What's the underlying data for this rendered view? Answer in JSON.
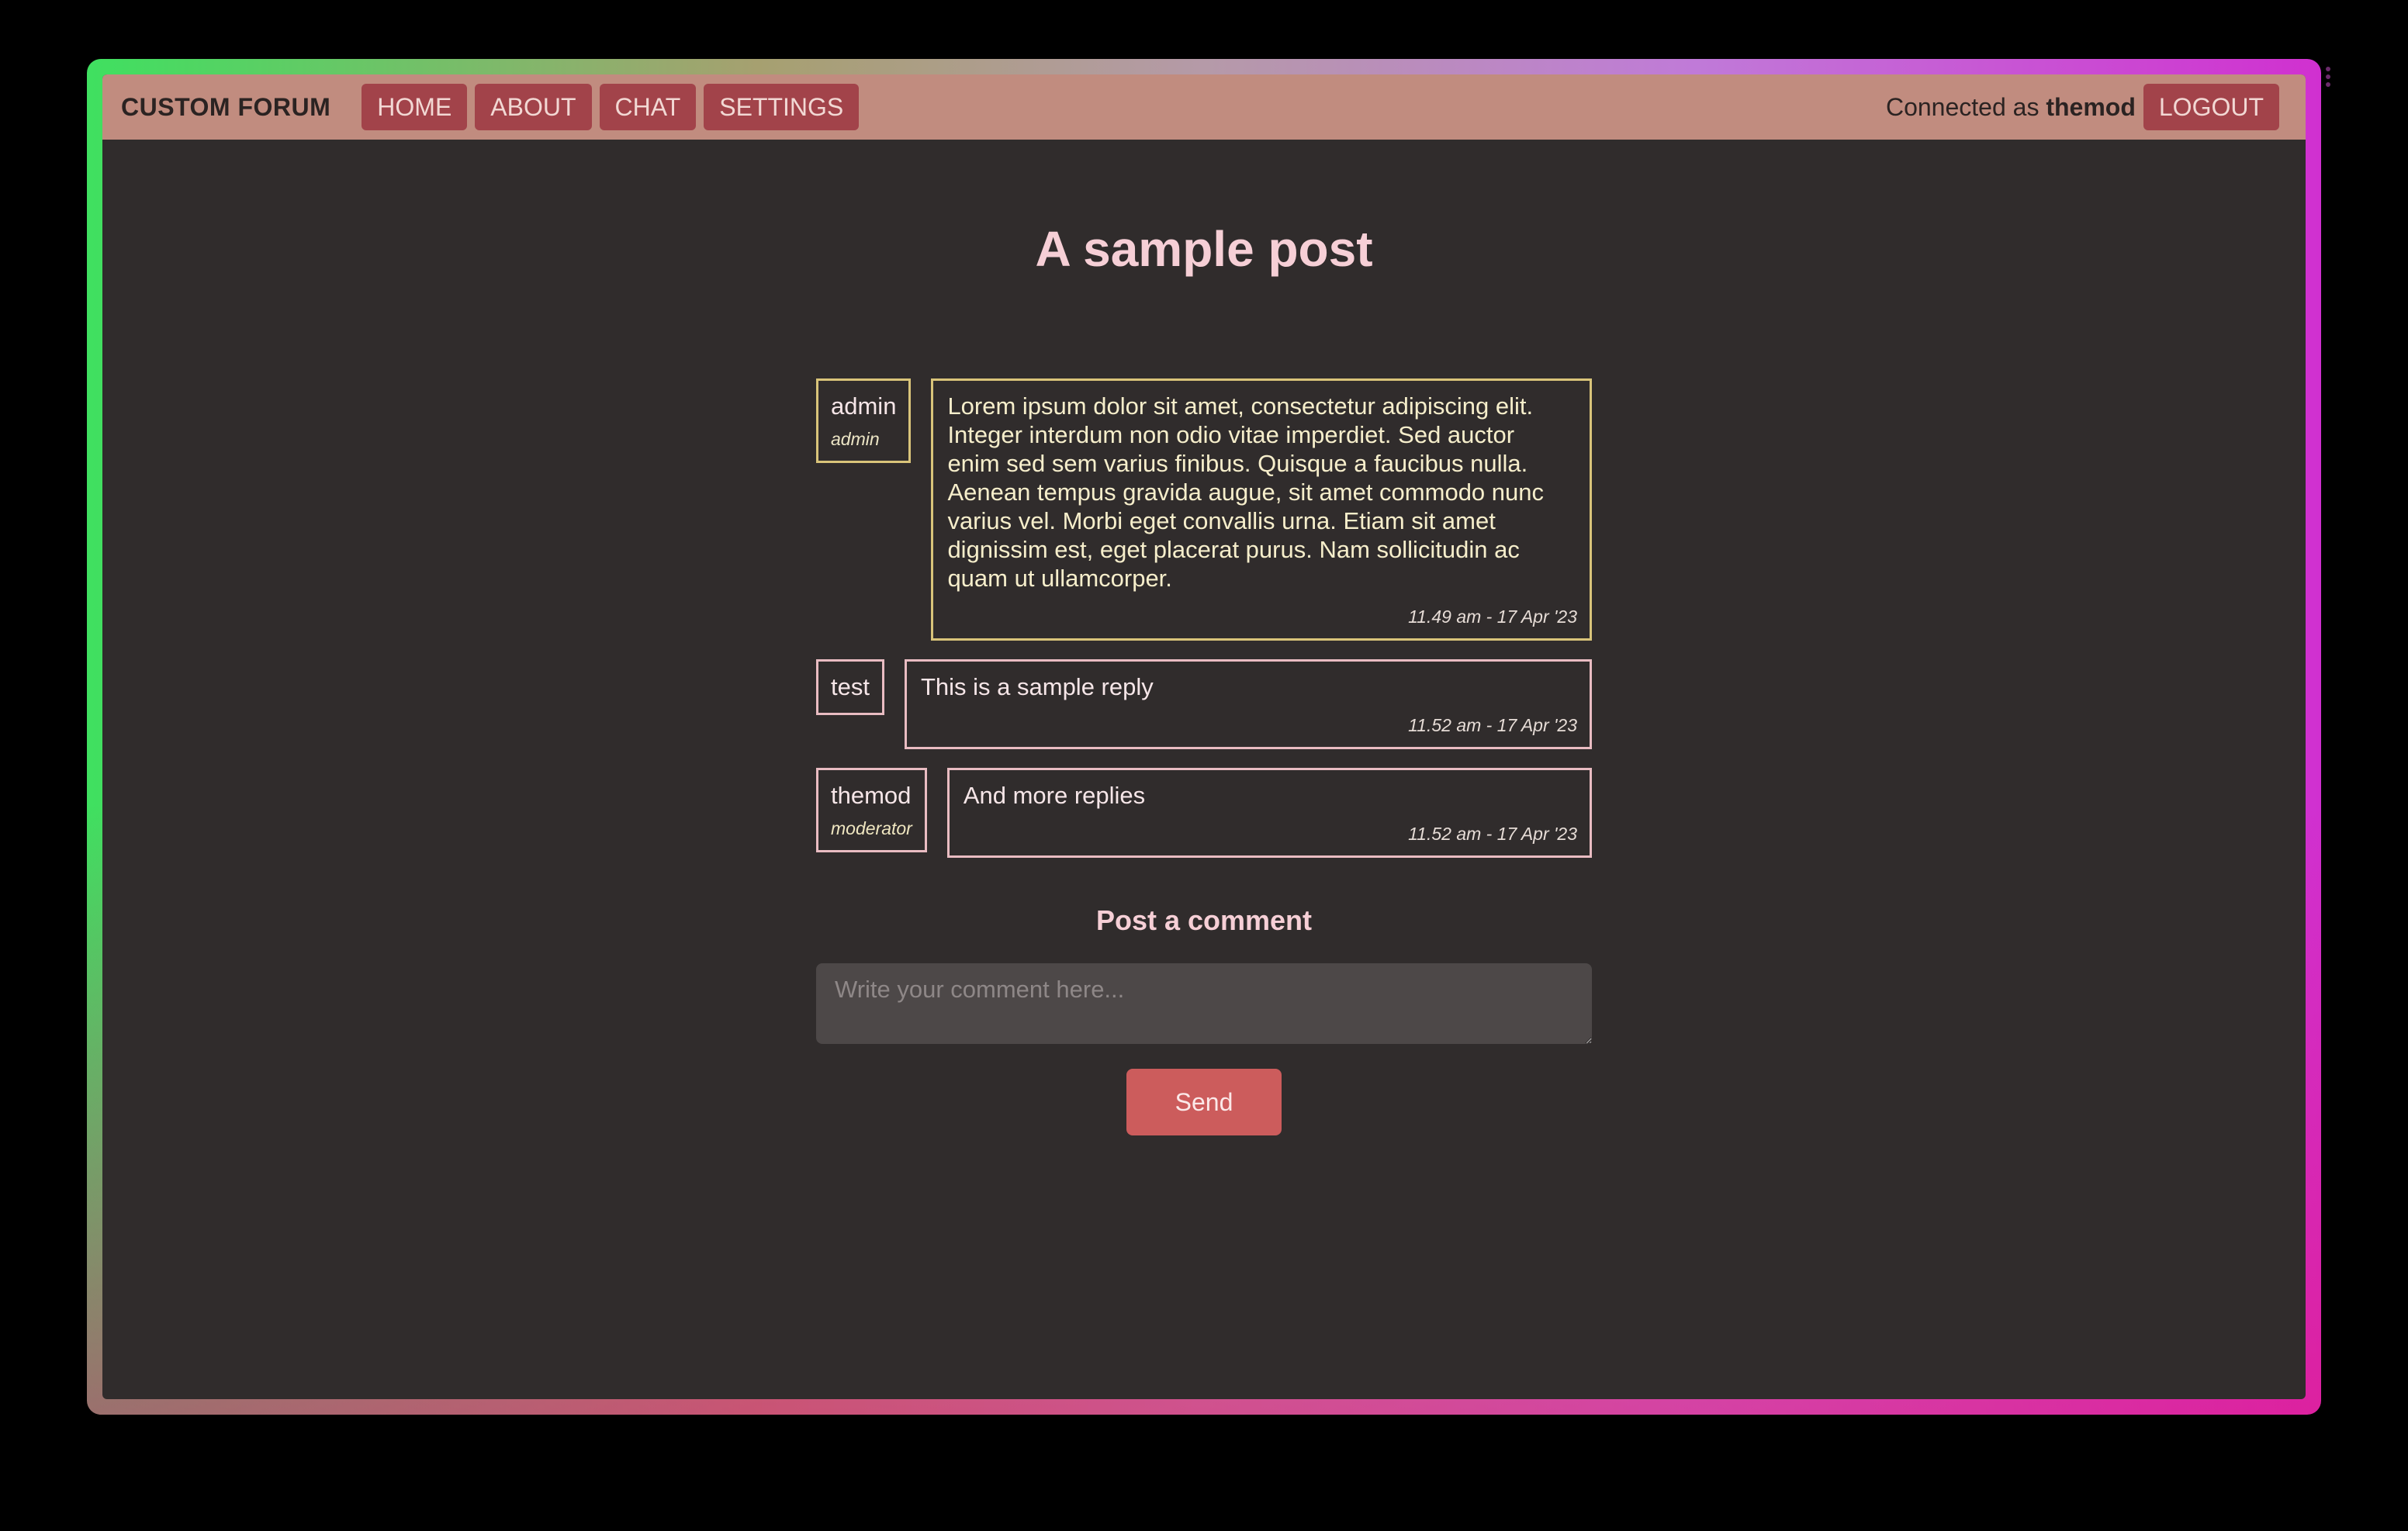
{
  "nav": {
    "brand": "CUSTOM FORUM",
    "items": [
      {
        "label": "HOME"
      },
      {
        "label": "ABOUT"
      },
      {
        "label": "CHAT"
      },
      {
        "label": "SETTINGS"
      }
    ],
    "connected_prefix": "Connected as",
    "username": "themod",
    "logout_label": "LOGOUT"
  },
  "post": {
    "title": "A sample post",
    "messages": [
      {
        "author": "admin",
        "role": "admin",
        "body": "Lorem ipsum dolor sit amet, consectetur adipiscing elit.\nInteger interdum non odio vitae imperdiet. Sed auctor\nenim sed sem varius finibus. Quisque a faucibus nulla.\nAenean tempus gravida augue, sit amet commodo nunc\nvarius vel. Morbi eget convallis urna. Etiam sit amet\ndignissim est, eget placerat purus. Nam sollicitudin ac\nquam ut ullamcorper.",
        "time": "11.49 am - 17 Apr '23"
      },
      {
        "author": "test",
        "body": "This is a sample reply",
        "time": "11.52 am - 17 Apr '23"
      },
      {
        "author": "themod",
        "role": "moderator",
        "body": "And more replies",
        "time": "11.52 am - 17 Apr '23"
      }
    ]
  },
  "comment": {
    "title": "Post a comment",
    "placeholder": "Write your comment here...",
    "send_label": "Send"
  },
  "colors": {
    "background": "#302c2c",
    "navbar": "#c18c7f",
    "nav_button": "#a2434a",
    "accent_pink": "#f6cfd6",
    "admin_border": "#d9c47a",
    "send_button": "#cc5c5c"
  }
}
